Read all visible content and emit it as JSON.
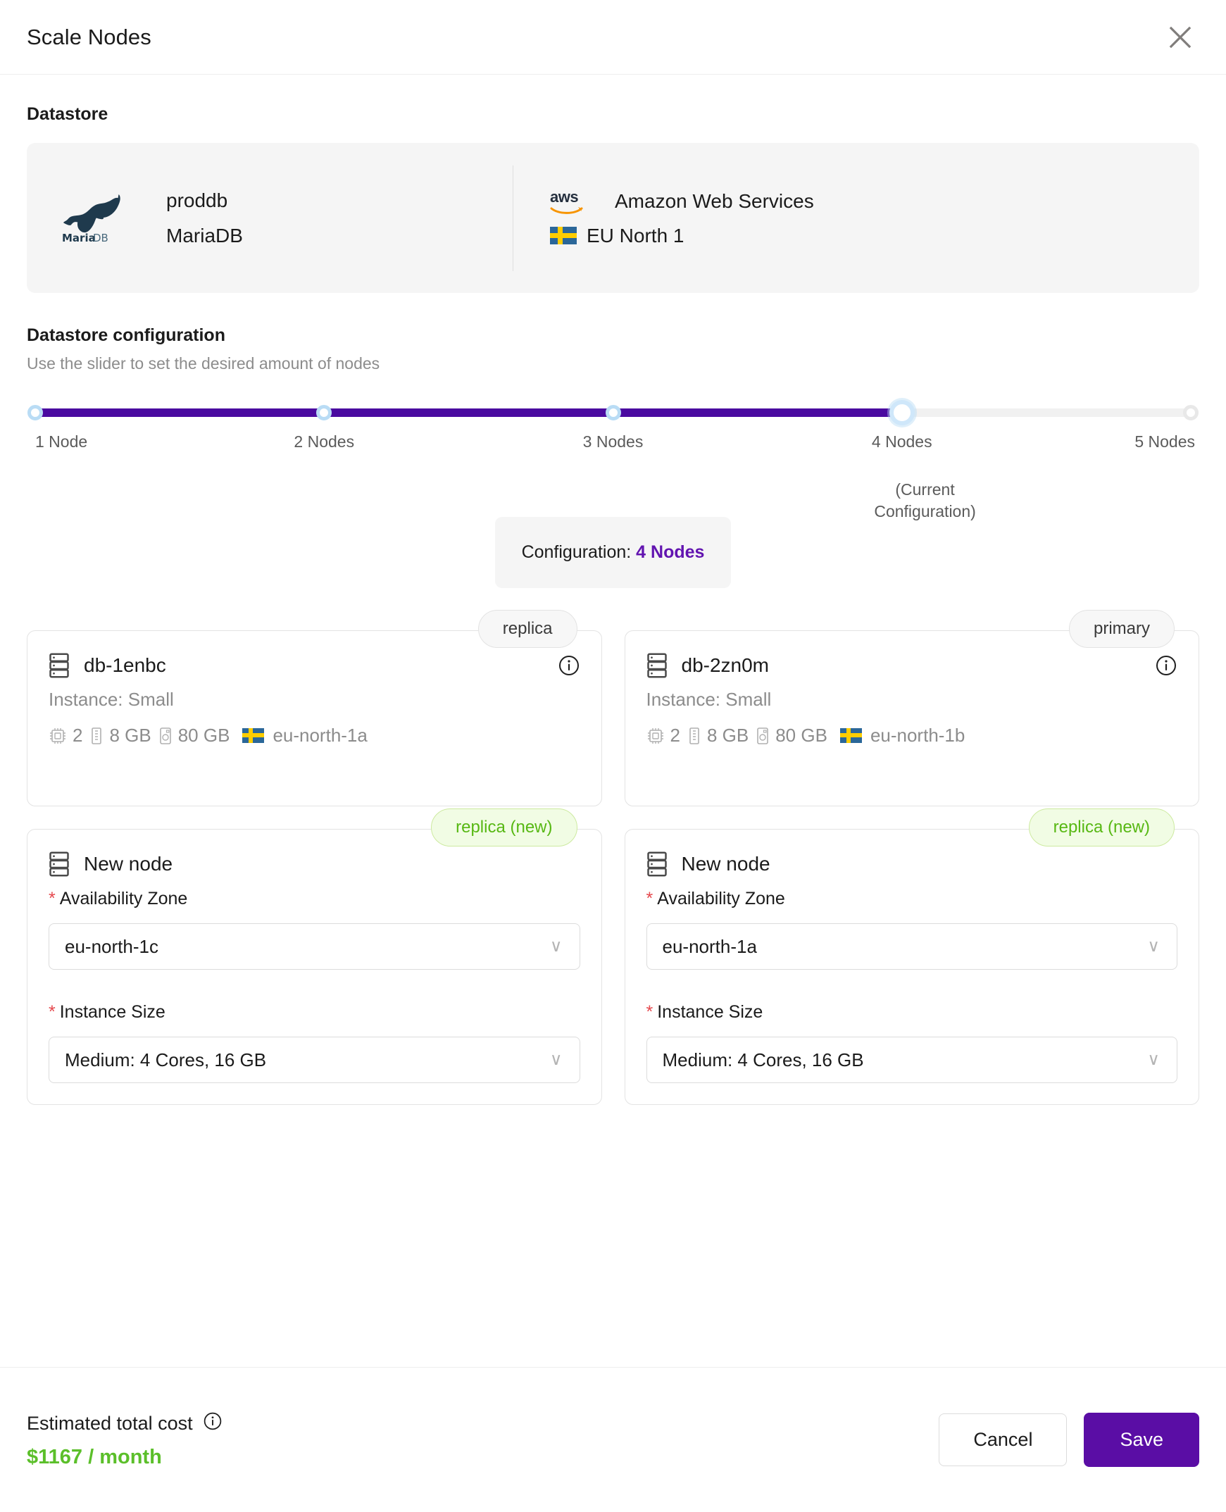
{
  "header": {
    "title": "Scale Nodes",
    "close_icon": "close-icon"
  },
  "datastore": {
    "section_title": "Datastore",
    "name": "proddb",
    "engine": "MariaDB",
    "engine_logo": "mariadb-logo",
    "provider_logo": "aws-logo",
    "provider": "Amazon Web Services",
    "region": "EU North 1",
    "region_flag": "sweden-flag-icon"
  },
  "configuration": {
    "section_title": "Datastore configuration",
    "subtitle": "Use the slider to set the desired amount of nodes",
    "slider": {
      "min": 1,
      "max": 5,
      "value": 4,
      "current_configuration": 4,
      "current_configuration_note": "(Current Configuration)",
      "ticks": [
        {
          "label": "1 Node",
          "value": 1,
          "state": "active"
        },
        {
          "label": "2 Nodes",
          "value": 2,
          "state": "active"
        },
        {
          "label": "3 Nodes",
          "value": 3,
          "state": "active"
        },
        {
          "label": "4 Nodes",
          "value": 4,
          "state": "current"
        },
        {
          "label": "5 Nodes",
          "value": 5,
          "state": "inactive"
        }
      ]
    },
    "summary_prefix": "Configuration: ",
    "summary_value": "4 Nodes",
    "accent_color": "#6214b0"
  },
  "nodes": [
    {
      "badge": "replica",
      "badge_type": "existing",
      "name": "db-1enbc",
      "instance": "Instance: Small",
      "cpu": "2",
      "ram": "8 GB",
      "disk": "80 GB",
      "az": "eu-north-1a",
      "info_icon": "info-icon",
      "rack_icon": "server-rack-icon"
    },
    {
      "badge": "primary",
      "badge_type": "existing",
      "name": "db-2zn0m",
      "instance": "Instance: Small",
      "cpu": "2",
      "ram": "8 GB",
      "disk": "80 GB",
      "az": "eu-north-1b",
      "info_icon": "info-icon",
      "rack_icon": "server-rack-icon"
    }
  ],
  "new_nodes": [
    {
      "badge": "replica (new)",
      "badge_type": "new",
      "title": "New node",
      "az_label": "Availability Zone",
      "az_value": "eu-north-1c",
      "size_label": "Instance Size",
      "size_value": "Medium: 4 Cores, 16 GB",
      "required_marker": "*",
      "chevron": "∨"
    },
    {
      "badge": "replica (new)",
      "badge_type": "new",
      "title": "New node",
      "az_label": "Availability Zone",
      "az_value": "eu-north-1a",
      "size_label": "Instance Size",
      "size_value": "Medium: 4 Cores, 16 GB",
      "required_marker": "*",
      "chevron": "∨"
    }
  ],
  "footer": {
    "cost_label": "Estimated total cost",
    "cost_info_icon": "info-icon",
    "cost_value": "$1167 / month",
    "cost_color": "#5bbf2a",
    "cancel_label": "Cancel",
    "save_label": "Save"
  }
}
